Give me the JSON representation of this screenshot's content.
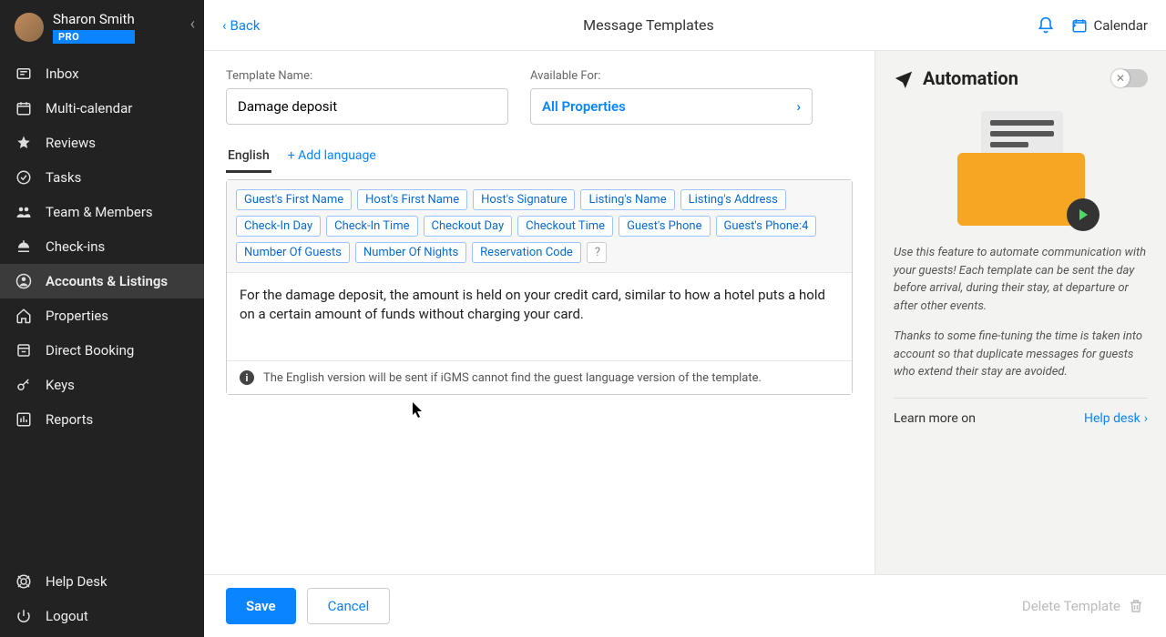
{
  "user": {
    "name": "Sharon Smith",
    "badge": "PRO"
  },
  "sidebar": {
    "items": [
      {
        "label": "Inbox"
      },
      {
        "label": "Multi-calendar"
      },
      {
        "label": "Reviews"
      },
      {
        "label": "Tasks"
      },
      {
        "label": "Team & Members"
      },
      {
        "label": "Check-ins"
      },
      {
        "label": "Accounts & Listings"
      },
      {
        "label": "Properties"
      },
      {
        "label": "Direct Booking"
      },
      {
        "label": "Keys"
      },
      {
        "label": "Reports"
      }
    ],
    "bottom": [
      {
        "label": "Help Desk"
      },
      {
        "label": "Logout"
      }
    ]
  },
  "topbar": {
    "back": "Back",
    "title": "Message Templates",
    "calendar": "Calendar"
  },
  "form": {
    "template_name_label": "Template Name:",
    "template_name_value": "Damage deposit",
    "available_for_label": "Available For:",
    "available_for_value": "All Properties",
    "lang_tab": "English",
    "add_lang": "+ Add language",
    "tokens": [
      "Guest's First Name",
      "Host's First Name",
      "Host's Signature",
      "Listing's Name",
      "Listing's Address",
      "Check-In Day",
      "Check-In Time",
      "Checkout Day",
      "Checkout Time",
      "Guest's Phone",
      "Guest's Phone:4",
      "Number Of Guests",
      "Number Of Nights",
      "Reservation Code"
    ],
    "token_help": "?",
    "body": "For the damage deposit, the amount is held on your credit card, similar to how a hotel puts a hold on a certain amount of funds without charging your card.",
    "fallback_note": "The English version will be sent if iGMS cannot find the guest language version of the template."
  },
  "actions": {
    "save": "Save",
    "cancel": "Cancel",
    "delete": "Delete Template"
  },
  "right": {
    "title": "Automation",
    "para1": "Use this feature to automate communication with your guests! Each template can be sent the day before arrival, during their stay, at departure or after other events.",
    "para2": "Thanks to some fine-tuning the time is taken into account so that duplicate messages for guests who extend their stay are avoided.",
    "learn": "Learn more on",
    "help": "Help desk"
  }
}
